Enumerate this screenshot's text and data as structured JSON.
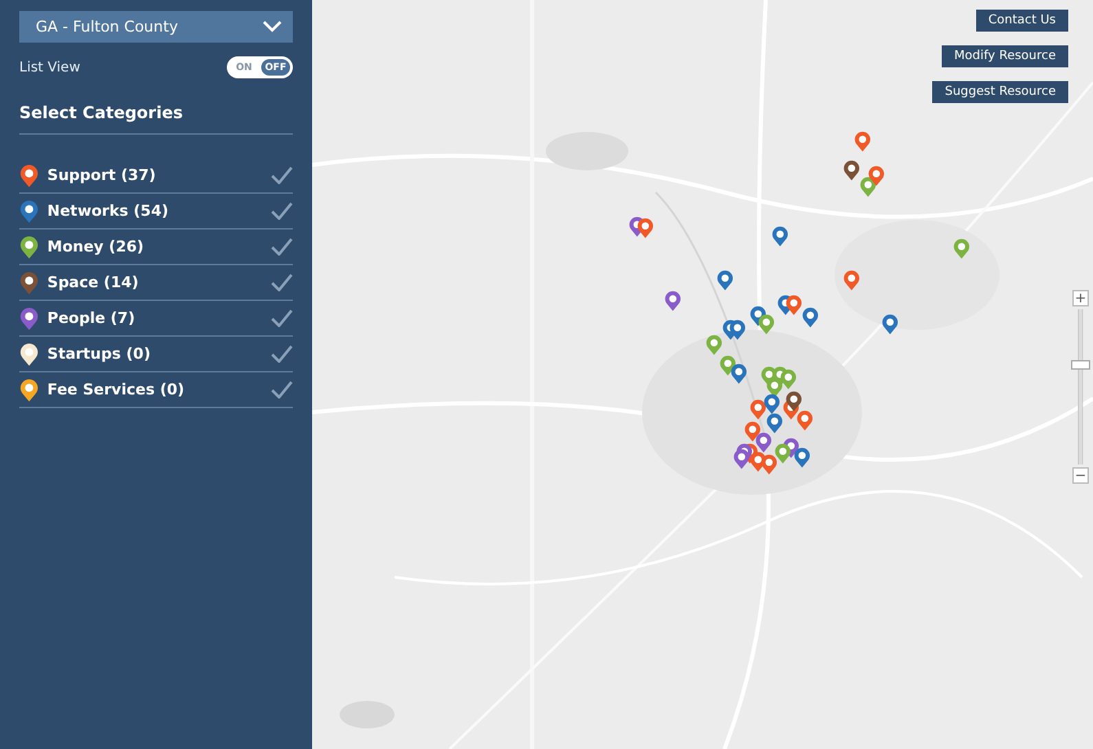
{
  "sidebar": {
    "region_select": {
      "value": "GA - Fulton County"
    },
    "list_view": {
      "label": "List View",
      "on_label": "ON",
      "off_label": "OFF",
      "on": false
    },
    "categories_heading": "Select Categories",
    "categories": [
      {
        "label": "Support (37)",
        "color": "#f05a28",
        "checked": true
      },
      {
        "label": "Networks (54)",
        "color": "#2a74bb",
        "checked": true
      },
      {
        "label": "Money (26)",
        "color": "#7cb342",
        "checked": true
      },
      {
        "label": "Space (14)",
        "color": "#7b5238",
        "checked": true
      },
      {
        "label": "People (7)",
        "color": "#8a5cc9",
        "checked": true
      },
      {
        "label": "Startups (0)",
        "color": "#f6e7cf",
        "checked": true
      },
      {
        "label": "Fee Services (0)",
        "color": "#f5a623",
        "checked": true
      }
    ]
  },
  "map": {
    "kind": "picture",
    "buttons": [
      "Contact Us",
      "Modify Resource",
      "Suggest Resource"
    ],
    "zoom": {
      "plus": "+",
      "minus": "−",
      "level": 0.65
    }
  }
}
